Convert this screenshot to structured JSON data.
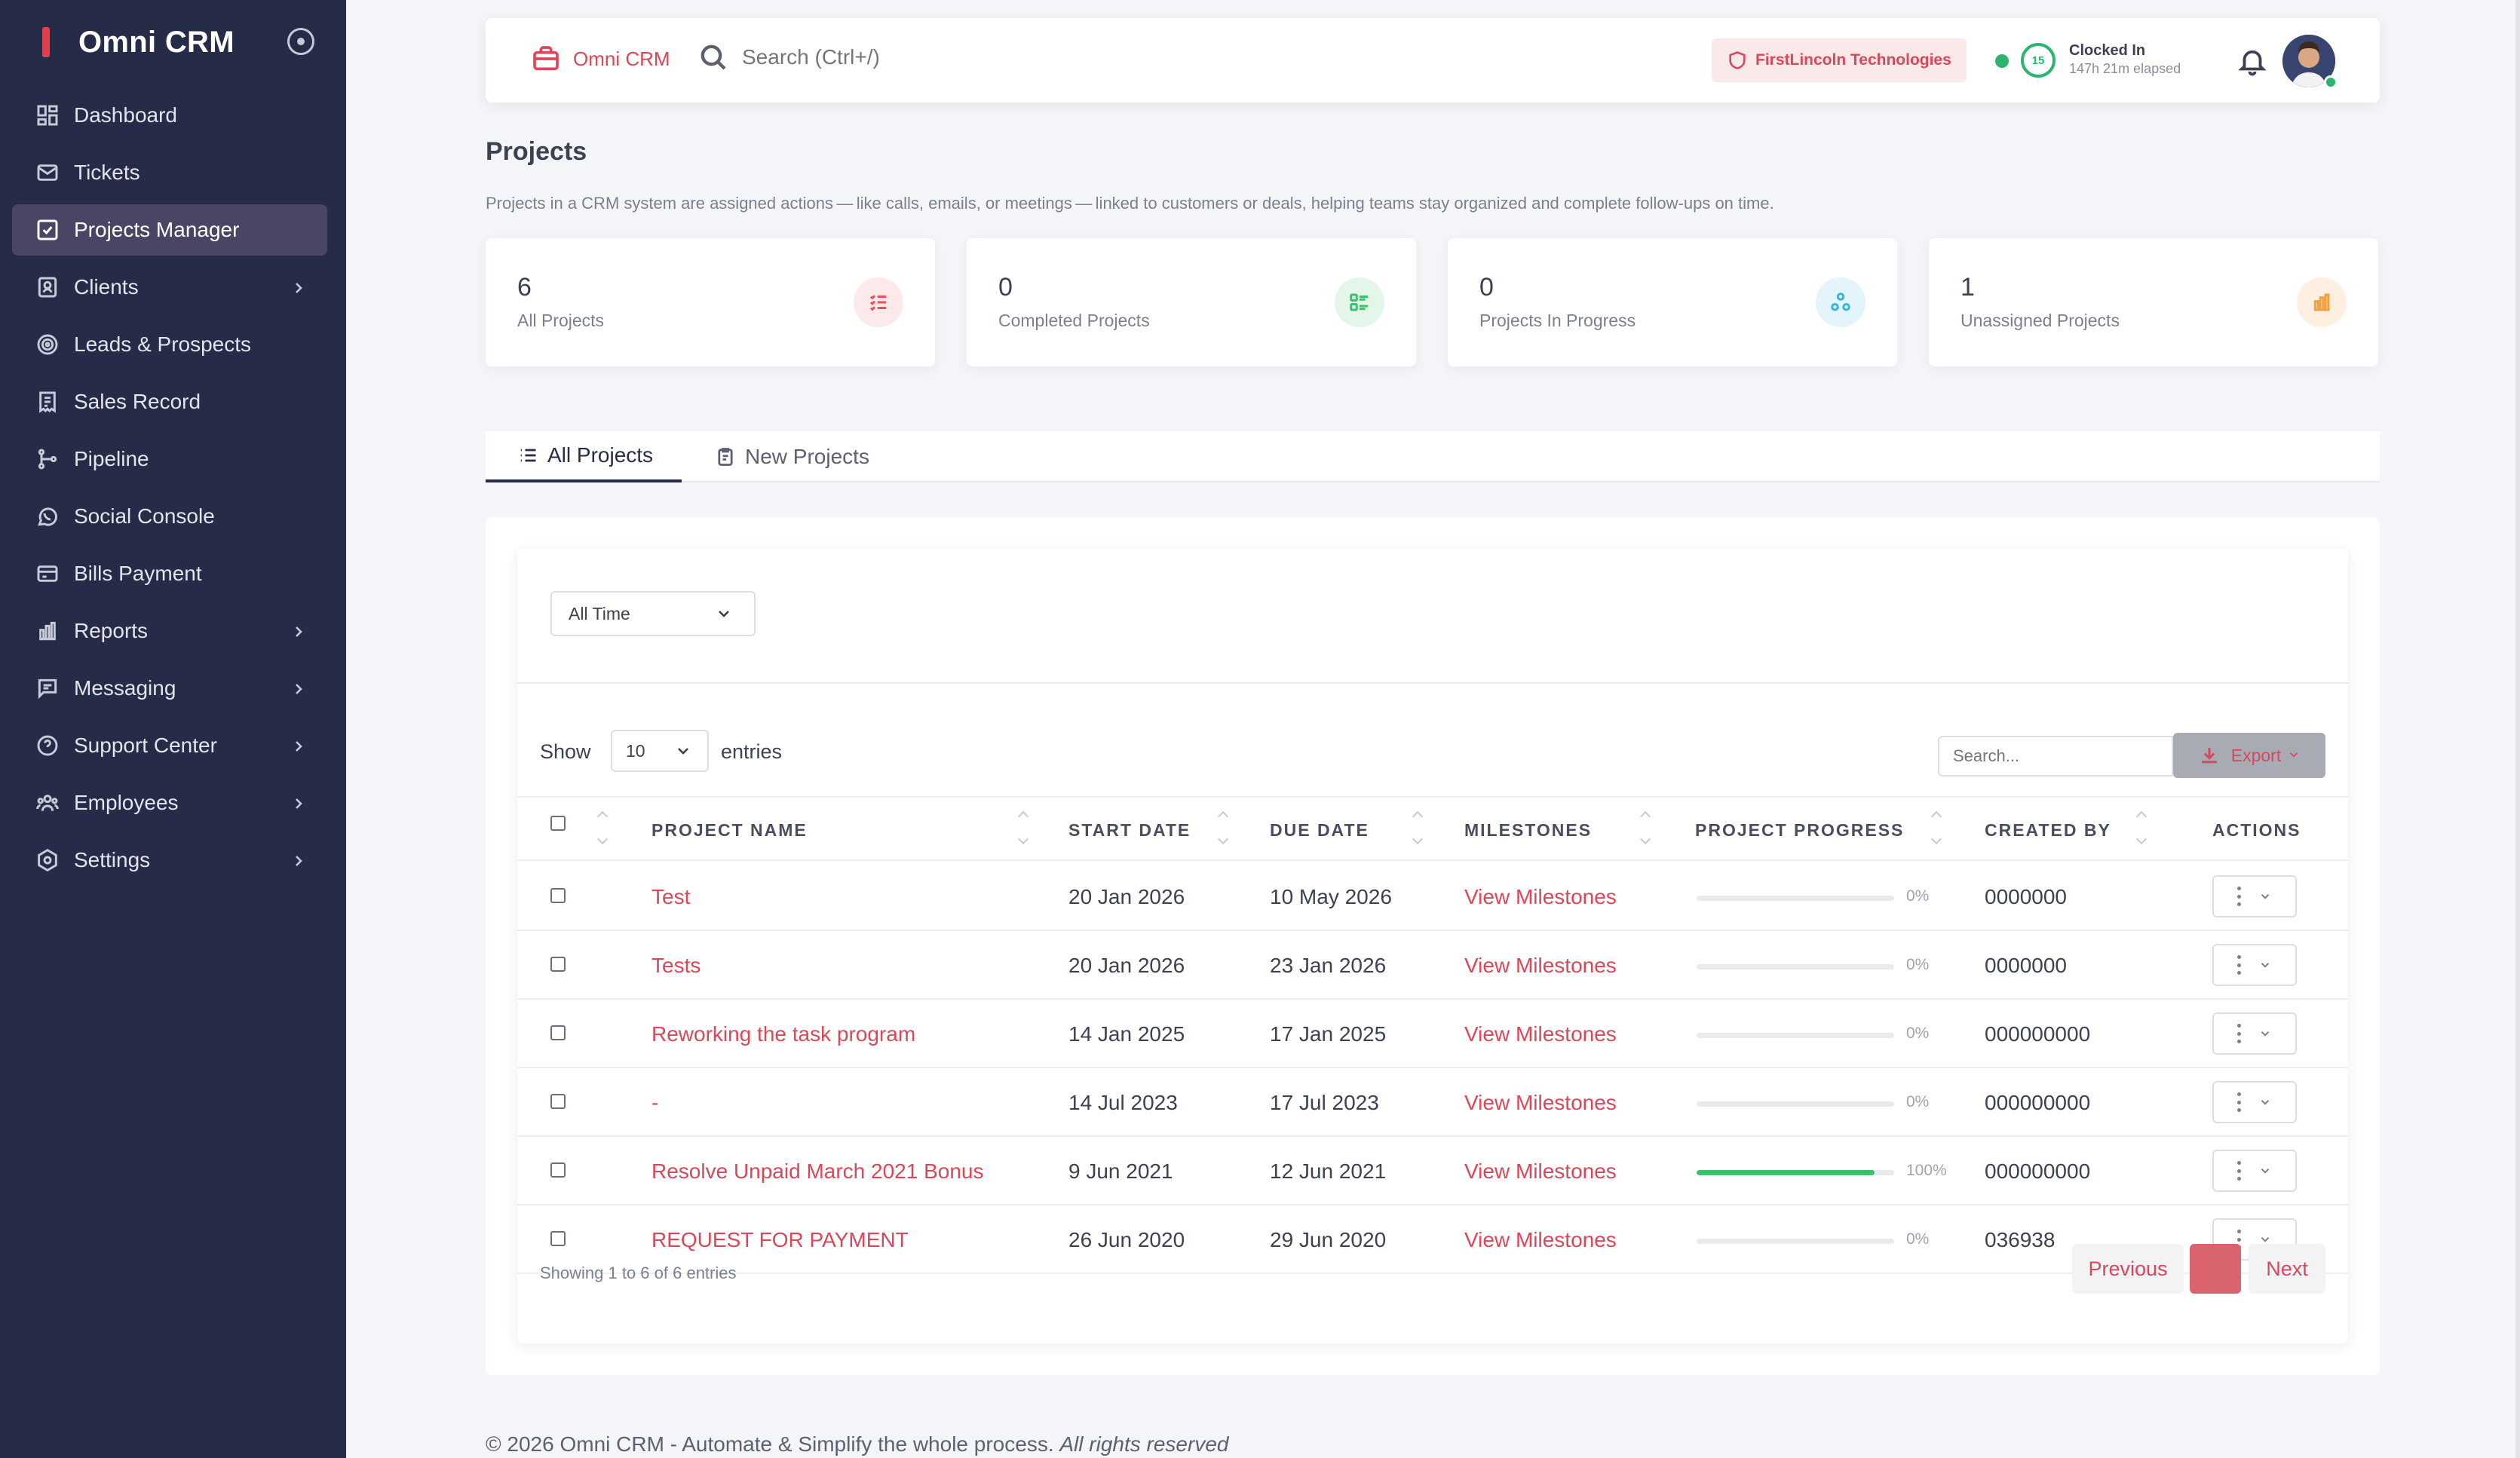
{
  "app": {
    "name": "Omni CRM"
  },
  "sidebar": {
    "items": [
      {
        "label": "Dashboard",
        "icon": "dashboard-icon",
        "active": false,
        "has_children": false
      },
      {
        "label": "Tickets",
        "icon": "mail-icon",
        "active": false,
        "has_children": false
      },
      {
        "label": "Projects Manager",
        "icon": "check-square-icon",
        "active": true,
        "has_children": false
      },
      {
        "label": "Clients",
        "icon": "clients-icon",
        "active": false,
        "has_children": true
      },
      {
        "label": "Leads & Prospects",
        "icon": "target-icon",
        "active": false,
        "has_children": false
      },
      {
        "label": "Sales Record",
        "icon": "receipt-icon",
        "active": false,
        "has_children": false
      },
      {
        "label": "Pipeline",
        "icon": "pipeline-icon",
        "active": false,
        "has_children": false
      },
      {
        "label": "Social Console",
        "icon": "whatsapp-icon",
        "active": false,
        "has_children": false
      },
      {
        "label": "Bills Payment",
        "icon": "credit-card-icon",
        "active": false,
        "has_children": false
      },
      {
        "label": "Reports",
        "icon": "bar-chart-icon",
        "active": false,
        "has_children": true
      },
      {
        "label": "Messaging",
        "icon": "message-icon",
        "active": false,
        "has_children": true
      },
      {
        "label": "Support Center",
        "icon": "help-circle-icon",
        "active": false,
        "has_children": true
      },
      {
        "label": "Employees",
        "icon": "users-icon",
        "active": false,
        "has_children": true
      },
      {
        "label": "Settings",
        "icon": "settings-icon",
        "active": false,
        "has_children": true
      }
    ]
  },
  "topbar": {
    "crm_label": "Omni CRM",
    "search_placeholder": "Search (Ctrl+/)",
    "company": "FirstLincoln Technologies",
    "clock_count": "15",
    "clock_title": "Clocked In",
    "clock_elapsed": "147h 21m elapsed"
  },
  "page": {
    "title": "Projects",
    "description": "Projects in a CRM system are assigned actions — like calls, emails, or meetings — linked to customers or deals, helping teams stay organized and complete follow-ups on time."
  },
  "stats": [
    {
      "value": "6",
      "label": "All Projects",
      "icon": "list-check-icon",
      "color": "#e8505b",
      "bg": "#fceaea"
    },
    {
      "value": "0",
      "label": "Completed Projects",
      "icon": "list-done-icon",
      "color": "#3fbf6d",
      "bg": "#e4f6ea"
    },
    {
      "value": "0",
      "label": "Projects In Progress",
      "icon": "nodes-icon",
      "color": "#38b6d8",
      "bg": "#e3f5fa"
    },
    {
      "value": "1",
      "label": "Unassigned Projects",
      "icon": "bar-chart-icon",
      "color": "#f29f3f",
      "bg": "#fdf0e1"
    }
  ],
  "tabs": [
    {
      "label": "All Projects",
      "active": true
    },
    {
      "label": "New Projects",
      "active": false
    }
  ],
  "filters": {
    "period": "All Time",
    "show_label": "Show",
    "entries_value": "10",
    "entries_label": "entries",
    "search_placeholder": "Search...",
    "export_label": "Export"
  },
  "table": {
    "columns": [
      "PROJECT NAME",
      "START DATE",
      "DUE DATE",
      "MILESTONES",
      "PROJECT PROGRESS",
      "CREATED BY",
      "ACTIONS"
    ],
    "rows": [
      {
        "name": "Test",
        "start": "20 Jan 2026",
        "due": "10 May 2026",
        "milestones": "View Milestones",
        "progress": 0,
        "progress_label": "0%",
        "created_by": "0000000"
      },
      {
        "name": "Tests",
        "start": "20 Jan 2026",
        "due": "23 Jan 2026",
        "milestones": "View Milestones",
        "progress": 0,
        "progress_label": "0%",
        "created_by": "0000000"
      },
      {
        "name": "Reworking the task program",
        "start": "14 Jan 2025",
        "due": "17 Jan 2025",
        "milestones": "View Milestones",
        "progress": 0,
        "progress_label": "0%",
        "created_by": "000000000"
      },
      {
        "name": "-",
        "start": "14 Jul 2023",
        "due": "17 Jul 2023",
        "milestones": "View Milestones",
        "progress": 0,
        "progress_label": "0%",
        "created_by": "000000000"
      },
      {
        "name": "Resolve Unpaid March 2021 Bonus",
        "start": "9 Jun 2021",
        "due": "12 Jun 2021",
        "milestones": "View Milestones",
        "progress": 100,
        "progress_label": "100%",
        "created_by": "000000000"
      },
      {
        "name": "REQUEST FOR PAYMENT",
        "start": "26 Jun 2020",
        "due": "29 Jun 2020",
        "milestones": "View Milestones",
        "progress": 0,
        "progress_label": "0%",
        "created_by": "036938"
      }
    ]
  },
  "pagination": {
    "summary": "Showing 1 to 6 of 6 entries",
    "previous": "Previous",
    "current_page": "",
    "next": "Next"
  },
  "footer": {
    "text": "© 2026 Omni CRM - Automate & Simplify the whole process. ",
    "rights": "All rights reserved"
  }
}
